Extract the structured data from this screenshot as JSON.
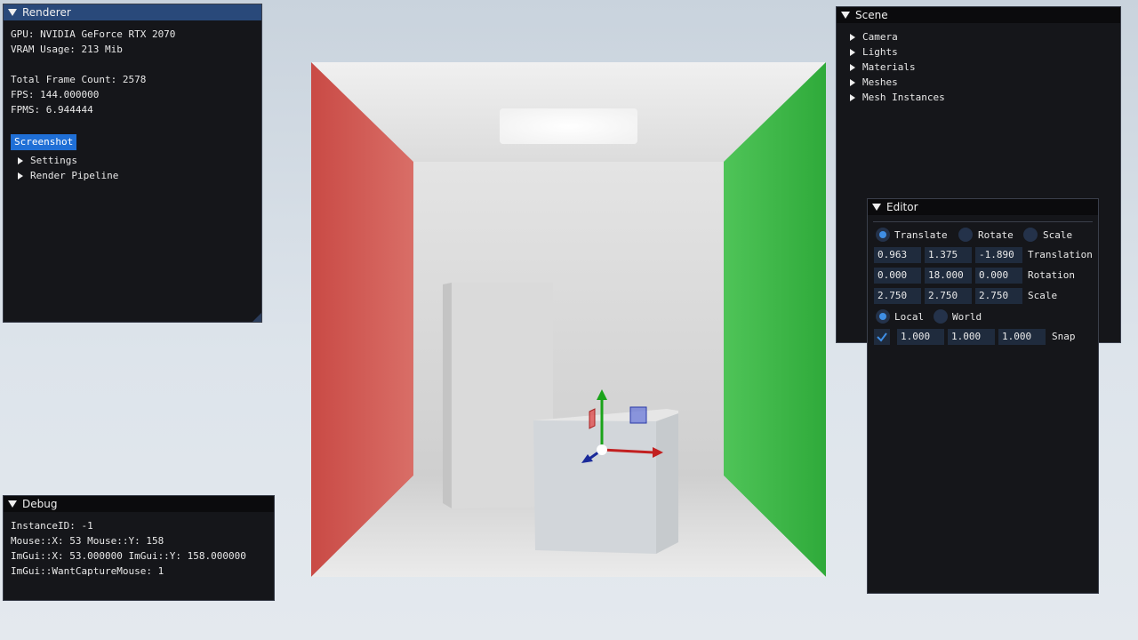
{
  "renderer": {
    "title": "Renderer",
    "gpu": "GPU: NVIDIA GeForce RTX 2070",
    "vram": "VRAM Usage: 213 Mib",
    "frames": "Total Frame Count: 2578",
    "fps": "FPS: 144.000000",
    "fpms": "FPMS: 6.944444",
    "screenshot_label": "Screenshot",
    "tree": [
      "Settings",
      "Render Pipeline"
    ]
  },
  "debug": {
    "title": "Debug",
    "lines": [
      "InstanceID: -1",
      "Mouse::X: 53 Mouse::Y: 158",
      "ImGui::X: 53.000000 ImGui::Y: 158.000000",
      "ImGui::WantCaptureMouse: 1"
    ]
  },
  "scene": {
    "title": "Scene",
    "items": [
      "Camera",
      "Lights",
      "Materials",
      "Meshes",
      "Mesh Instances"
    ]
  },
  "editor": {
    "title": "Editor",
    "modes": [
      {
        "label": "Translate",
        "selected": true
      },
      {
        "label": "Rotate",
        "selected": false
      },
      {
        "label": "Scale",
        "selected": false
      }
    ],
    "rows": [
      {
        "label": "Translation",
        "values": [
          "0.963",
          "1.375",
          "-1.890"
        ]
      },
      {
        "label": "Rotation",
        "values": [
          "0.000",
          "18.000",
          "0.000"
        ]
      },
      {
        "label": "Scale",
        "values": [
          "2.750",
          "2.750",
          "2.750"
        ]
      }
    ],
    "space": [
      {
        "label": "Local",
        "selected": true
      },
      {
        "label": "World",
        "selected": false
      }
    ],
    "snap": {
      "enabled": true,
      "values": [
        "1.000",
        "1.000",
        "1.000"
      ],
      "label": "Snap"
    }
  },
  "colors": {
    "left_wall": "#c8443e",
    "right_wall": "#2fb13a",
    "back_wall": "#d8d8d8",
    "accent": "#1f6fd6"
  }
}
